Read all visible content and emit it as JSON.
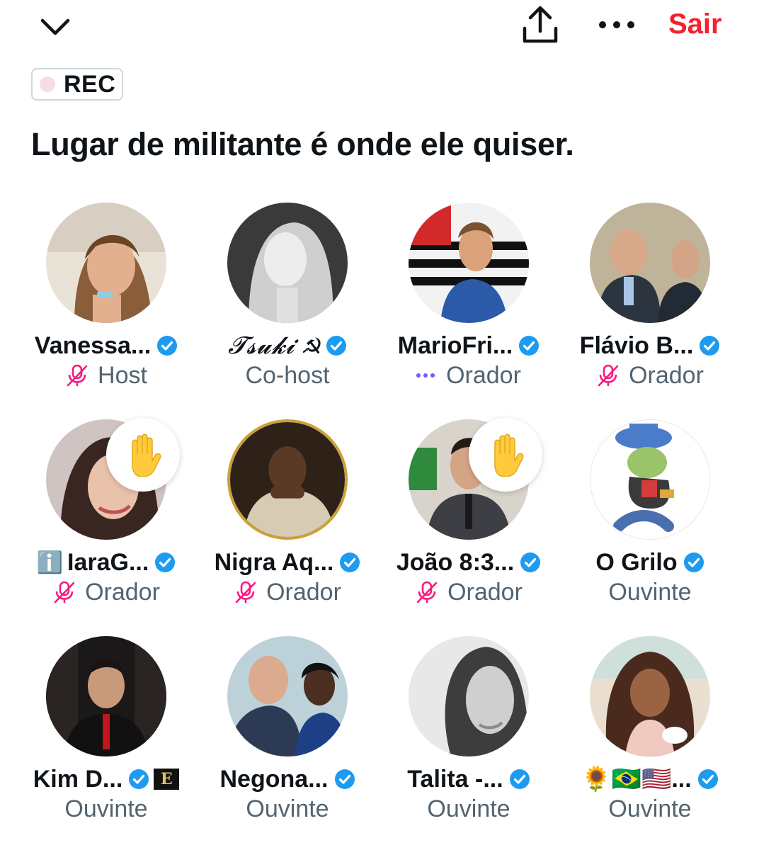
{
  "header": {
    "collapse_icon": "chevron-down-icon",
    "share_icon": "share-upload-icon",
    "more_icon": "more-horizontal-icon",
    "leave_label": "Sair"
  },
  "rec": {
    "label": "REC"
  },
  "space": {
    "title": "Lugar de militante é onde ele quiser."
  },
  "participants": [
    {
      "name": "Vanessa...",
      "role": "Host",
      "verified": true,
      "mic": "muted",
      "hand_raised": false
    },
    {
      "name": "𝓣𝓼𝓾𝓴𝓲 ☭",
      "role": "Co-host",
      "verified": true,
      "mic": "none",
      "hand_raised": false
    },
    {
      "name": "MarioFri...",
      "role": "Orador",
      "verified": true,
      "mic": "speaking",
      "hand_raised": false
    },
    {
      "name": "Flávio B...",
      "role": "Orador",
      "verified": true,
      "mic": "muted",
      "hand_raised": false
    },
    {
      "prefix": "ℹ️",
      "name": "IaraG...",
      "role": "Orador",
      "verified": true,
      "mic": "muted",
      "hand_raised": true
    },
    {
      "name": "Nigra Aq...",
      "role": "Orador",
      "verified": true,
      "mic": "muted",
      "hand_raised": false
    },
    {
      "name": "João 8:3...",
      "role": "Orador",
      "verified": true,
      "mic": "muted",
      "hand_raised": true
    },
    {
      "name": "O Grilo",
      "role": "Ouvinte",
      "verified": true,
      "mic": "none",
      "hand_raised": false
    },
    {
      "name": "Kim D...",
      "role": "Ouvinte",
      "verified": true,
      "mic": "none",
      "hand_raised": false,
      "suffix_badge": "E"
    },
    {
      "name": "Negona...",
      "role": "Ouvinte",
      "verified": true,
      "mic": "none",
      "hand_raised": false
    },
    {
      "name": "Talita -...",
      "role": "Ouvinte",
      "verified": true,
      "mic": "none",
      "hand_raised": false
    },
    {
      "name": "🌻🇧🇷🇺🇸...",
      "role": "Ouvinte",
      "verified": true,
      "mic": "none",
      "hand_raised": false
    }
  ],
  "colors": {
    "accent_red": "#f4212e",
    "verified_blue": "#1d9bf0",
    "muted_pink": "#f91880",
    "speaking_purple": "#7856ff",
    "secondary_text": "#536471"
  }
}
